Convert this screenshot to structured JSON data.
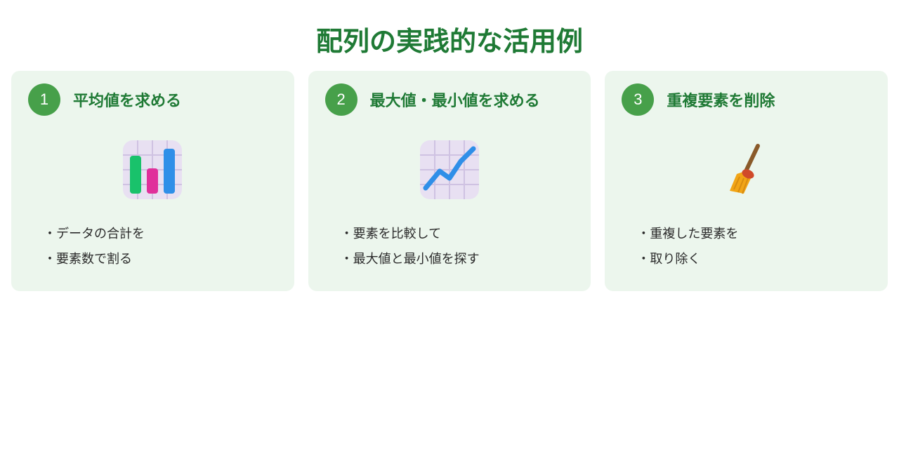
{
  "title": "配列の実践的な活用例",
  "cards": [
    {
      "num": "1",
      "title": "平均値を求める",
      "icon": "bar-chart",
      "bullets": [
        "データの合計を",
        "要素数で割る"
      ]
    },
    {
      "num": "2",
      "title": "最大値・最小値を求める",
      "icon": "line-chart",
      "bullets": [
        "要素を比較して",
        "最大値と最小値を探す"
      ]
    },
    {
      "num": "3",
      "title": "重複要素を削除",
      "icon": "broom",
      "bullets": [
        "重複した要素を",
        "取り除く"
      ]
    }
  ]
}
